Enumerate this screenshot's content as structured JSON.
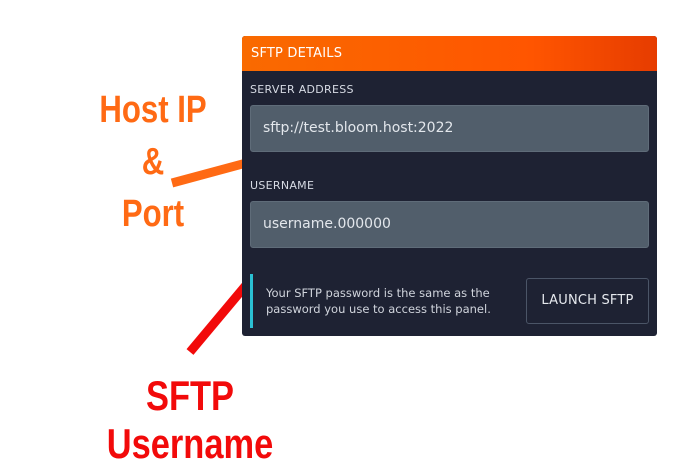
{
  "panel": {
    "title": "SFTP DETAILS",
    "server_address": {
      "label": "SERVER ADDRESS",
      "value": "sftp://test.bloom.host:2022"
    },
    "username": {
      "label": "USERNAME",
      "value": "username.000000"
    },
    "info_line1": "Your SFTP password is the same as the",
    "info_line2": "password you use to access this panel.",
    "launch_button": "LAUNCH SFTP"
  },
  "annotations": {
    "host_line1": "Host IP",
    "host_line2": "&",
    "host_line3": "Port",
    "username_label": "SFTP Username"
  },
  "colors": {
    "header_orange": "#ff5500",
    "annotation_orange": "#ff6a14",
    "annotation_red": "#f20a0a",
    "info_accent": "#2bc0d3"
  }
}
